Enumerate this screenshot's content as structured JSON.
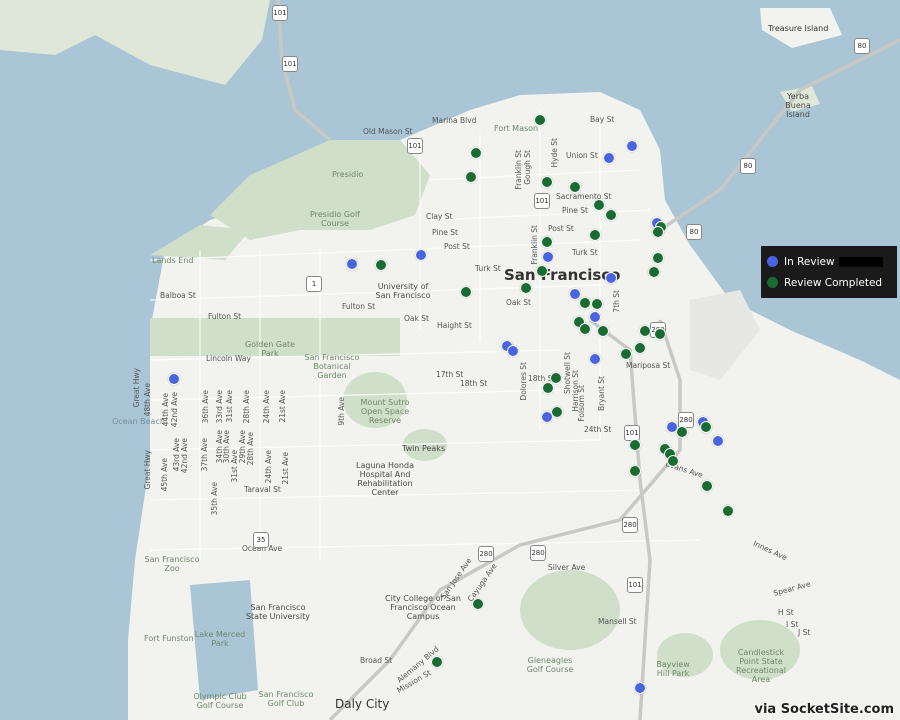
{
  "map": {
    "city_label": "San Francisco",
    "daly_city_label": "Daly City",
    "labels": {
      "treasure_island": "Treasure Island",
      "yerba_buena": "Yerba Buena Island",
      "fort_mason": "Fort Mason",
      "presidio": "Presidio",
      "presidio_golf": "Presidio Golf Course",
      "lands_end": "Lands End",
      "golden_gate_park": "Golden Gate Park",
      "sf_botanical": "San Francisco Botanical Garden",
      "usf": "University of San Francisco",
      "mt_sutro": "Mount Sutro Open Space Reserve",
      "twin_peaks": "Twin Peaks",
      "laguna_honda": "Laguna Honda Hospital And Rehabilitation Center",
      "ocean_beach": "Ocean Beach",
      "sf_zoo": "San Francisco Zoo",
      "sf_state": "San Francisco State University",
      "fort_funston": "Fort Funston",
      "lake_merced": "Lake Merced Park",
      "olympic_club": "Olympic Club Golf Course",
      "sf_golf": "San Francisco Golf Club",
      "city_college": "City College of San Francisco Ocean Campus",
      "gleneagles": "Gleneagles Golf Course",
      "bayview_hill": "Bayview Hill Park",
      "candlestick": "Candlestick Point State Recreational Area"
    },
    "streets": {
      "marina": "Marina Blvd",
      "bay": "Bay St",
      "old_mason": "Old Mason St",
      "union": "Union St",
      "clay": "Clay St",
      "pine": "Pine St",
      "post": "Post St",
      "sacramento": "Sacramento St",
      "pine2": "Pine St",
      "post2": "Post St",
      "turk": "Turk St",
      "turk2": "Turk St",
      "balboa": "Balboa St",
      "fulton": "Fulton St",
      "fulton2": "Fulton St",
      "oak": "Oak St",
      "oak2": "Oak St",
      "haight": "Haight St",
      "lincoln": "Lincoln Way",
      "mariposa": "Mariposa St",
      "st17": "17th St",
      "st18": "18th St",
      "st18b": "18th St",
      "st24": "24th St",
      "evans": "Evans Ave",
      "innes": "Innes Ave",
      "spear": "Spear Ave",
      "silver": "Silver Ave",
      "mansell": "Mansell St",
      "broad": "Broad St",
      "ocean": "Ocean Ave",
      "mission": "Mission St",
      "san_jose": "San Jose Ave",
      "cayuga": "Cayuga Ave",
      "alemany": "Alemany Blvd",
      "taraval": "Taraval St",
      "great_hwy": "Great Hwy",
      "great_hwy2": "Great Hwy",
      "hyde": "Hyde St",
      "franklin": "Franklin St",
      "gough": "Gough St",
      "franklin2": "Franklin St",
      "dolores": "Dolores St",
      "shotwell": "Shotwell St",
      "harrison": "Harrison St",
      "folsom": "Folsom St",
      "bryant": "Bryant St",
      "st7": "7th St",
      "h_st": "H St",
      "i_st": "I St",
      "j_st": "J St",
      "ave48": "48th Ave",
      "ave44": "44th Ave",
      "ave42": "42nd Ave",
      "ave45": "45th Ave",
      "ave43": "43rd Ave",
      "ave42b": "42nd Ave",
      "ave36": "36th Ave",
      "ave33": "33rd Ave",
      "ave31": "31st Ave",
      "ave28": "28th Ave",
      "ave24": "24th Ave",
      "ave21": "21st Ave",
      "ave9": "9th Ave",
      "ave37": "37th Ave",
      "ave34": "34th Ave",
      "ave35": "35th Ave",
      "ave30": "30th Ave",
      "ave29": "29th Ave",
      "ave28b": "28th Ave",
      "ave31b": "31st Ave",
      "ave24b": "24th Ave",
      "ave21b": "21st Ave"
    },
    "highway_shields": [
      "101",
      "80",
      "80",
      "80",
      "280",
      "280",
      "280",
      "280",
      "101",
      "101",
      "101",
      "1",
      "35",
      "280",
      "101",
      "101"
    ]
  },
  "legend": {
    "in_review_label": "In Review",
    "completed_label": "Review Completed"
  },
  "colors": {
    "in_review": "#4a63e0",
    "completed": "#1a6b32",
    "water": "#a9c5d6",
    "land": "#f2f2ef",
    "park": "#cfdfc9"
  },
  "credit": "via SocketSite.com"
}
